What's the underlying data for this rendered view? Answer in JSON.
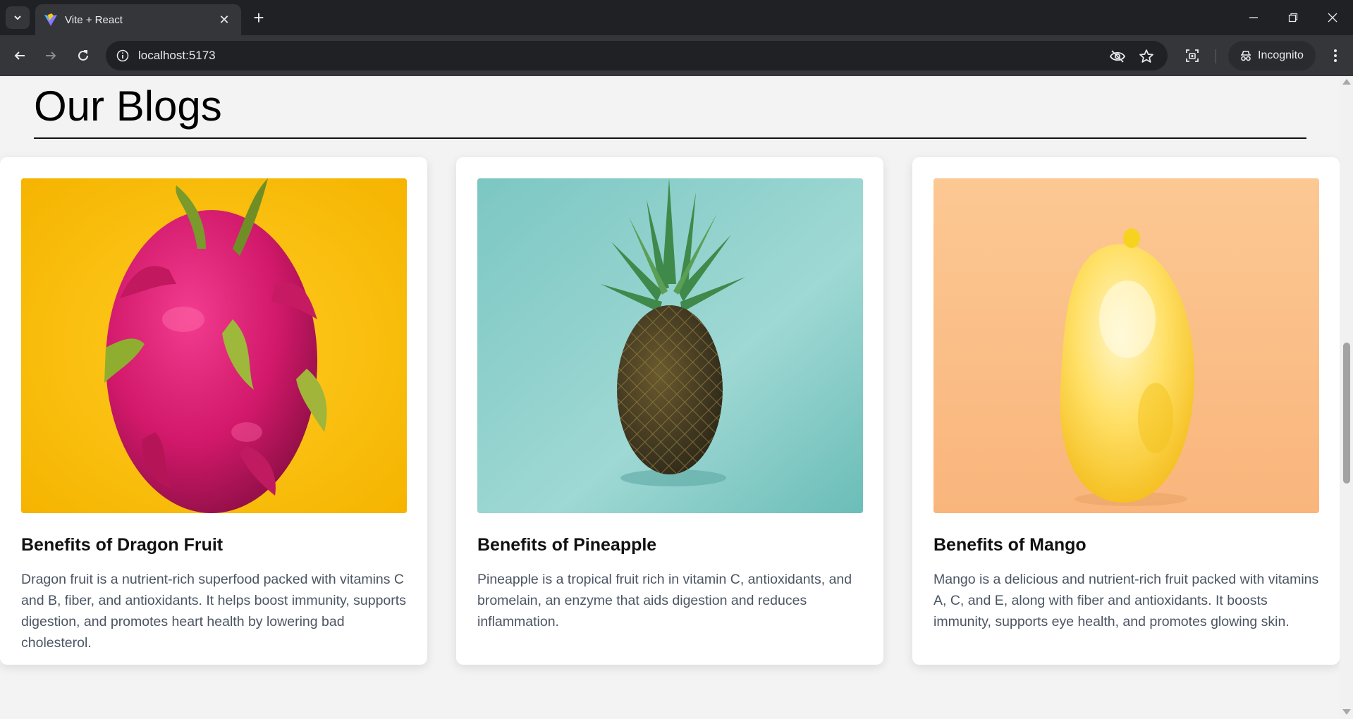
{
  "browser": {
    "tab_title": "Vite + React",
    "url": "localhost:5173",
    "incognito_label": "Incognito"
  },
  "page": {
    "heading": "Our Blogs",
    "cards": [
      {
        "title": "Benefits of Dragon Fruit",
        "text": "Dragon fruit is a nutrient-rich superfood packed with vitamins C and B, fiber, and antioxidants. It helps boost immunity, supports digestion, and promotes heart health by lowering bad cholesterol.",
        "image": "dragon-fruit-image",
        "image_bg": "#fbbf1a"
      },
      {
        "title": "Benefits of Pineapple",
        "text": "Pineapple is a tropical fruit rich in vitamin C, antioxidants, and bromelain, an enzyme that aids digestion and reduces inflammation.",
        "image": "pineapple-image",
        "image_bg": "#8fcfcb"
      },
      {
        "title": "Benefits of Mango",
        "text": "Mango is a delicious and nutrient-rich fruit packed with vitamins A, C, and E, along with fiber and antioxidants. It boosts immunity, supports eye health, and promotes glowing skin.",
        "image": "mango-image",
        "image_bg": "#fdc38e"
      }
    ]
  }
}
